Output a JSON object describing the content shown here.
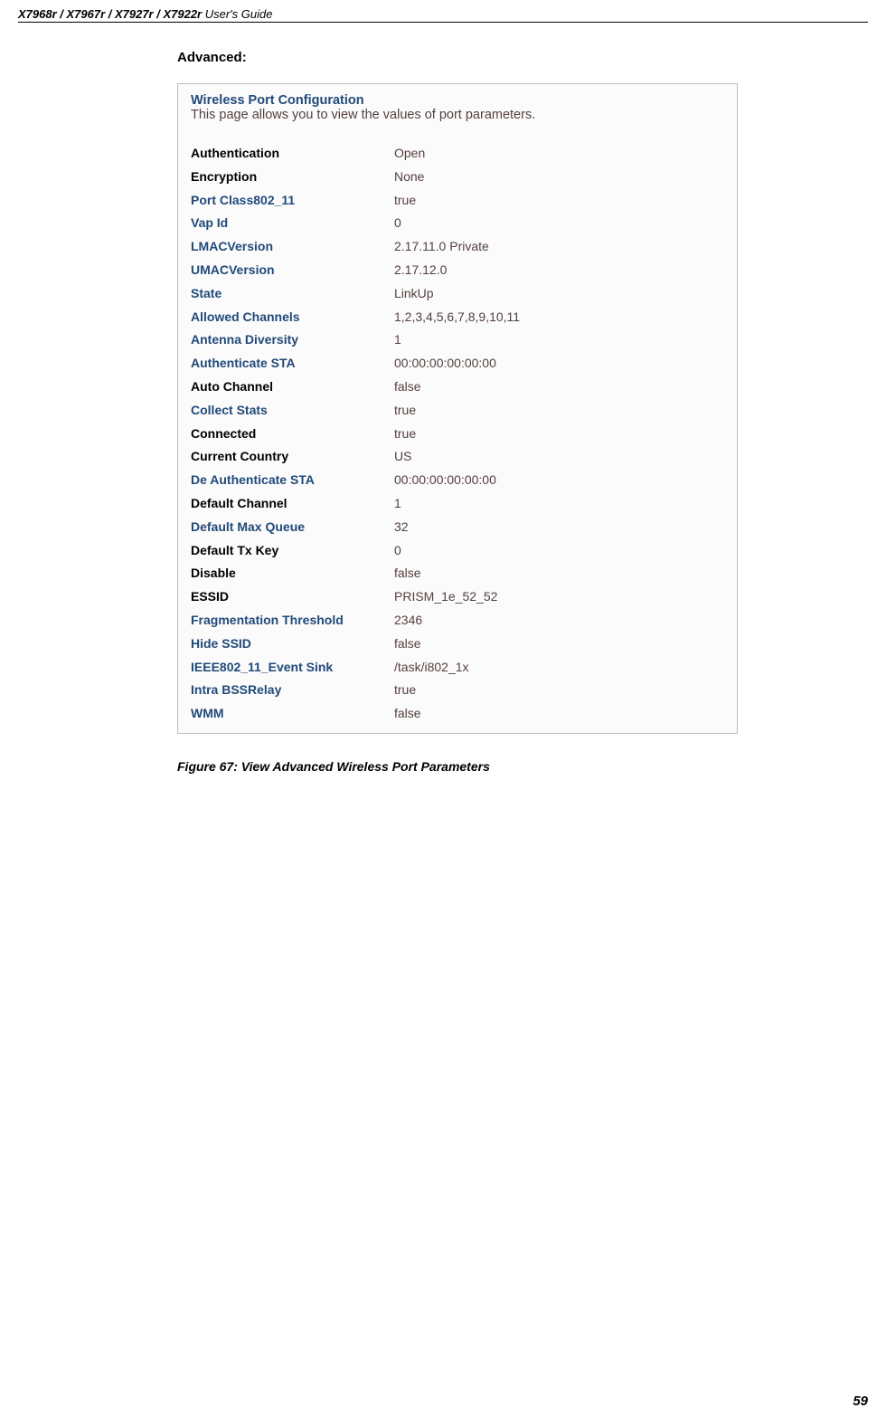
{
  "header": {
    "models": "X7968r / X7967r / X7927r / X7922r",
    "title_rest": " User's Guide"
  },
  "subheading": "Advanced:",
  "config": {
    "title": "Wireless Port Configuration",
    "desc": "This page allows you to view the values of port parameters."
  },
  "params": [
    {
      "label": "Authentication",
      "value": "Open",
      "style": "black"
    },
    {
      "label": "Encryption",
      "value": "None",
      "style": "black"
    },
    {
      "label": "Port Class802_11",
      "value": "true",
      "style": "blue"
    },
    {
      "label": "Vap Id",
      "value": "0",
      "style": "blue"
    },
    {
      "label": "LMACVersion",
      "value": "2.17.11.0 Private",
      "style": "blue"
    },
    {
      "label": "UMACVersion",
      "value": "2.17.12.0",
      "style": "blue"
    },
    {
      "label": "State",
      "value": "LinkUp",
      "style": "blue"
    },
    {
      "label": "Allowed Channels",
      "value": "1,2,3,4,5,6,7,8,9,10,11",
      "style": "blue"
    },
    {
      "label": "Antenna Diversity",
      "value": "1",
      "style": "blue"
    },
    {
      "label": "Authenticate STA",
      "value": "00:00:00:00:00:00",
      "style": "blue"
    },
    {
      "label": "Auto Channel",
      "value": "false",
      "style": "black"
    },
    {
      "label": "Collect Stats",
      "value": "true",
      "style": "blue"
    },
    {
      "label": "Connected",
      "value": "true",
      "style": "black"
    },
    {
      "label": "Current Country",
      "value": "US",
      "style": "black"
    },
    {
      "label": "De Authenticate STA",
      "value": "00:00:00:00:00:00",
      "style": "blue"
    },
    {
      "label": "Default Channel",
      "value": "1",
      "style": "black"
    },
    {
      "label": "Default Max Queue",
      "value": "32",
      "style": "blue"
    },
    {
      "label": "Default Tx Key",
      "value": "0",
      "style": "black"
    },
    {
      "label": "Disable",
      "value": "false",
      "style": "black"
    },
    {
      "label": "ESSID",
      "value": "PRISM_1e_52_52",
      "style": "black"
    },
    {
      "label": "Fragmentation Threshold",
      "value": "2346",
      "style": "blue"
    },
    {
      "label": "Hide SSID",
      "value": "false",
      "style": "blue"
    },
    {
      "label": "IEEE802_11_Event Sink",
      "value": "/task/i802_1x",
      "style": "blue"
    },
    {
      "label": "Intra BSSRelay",
      "value": "true",
      "style": "blue"
    },
    {
      "label": "WMM",
      "value": "false",
      "style": "blue"
    }
  ],
  "figure_caption": "Figure 67: View Advanced Wireless Port Parameters",
  "page_num": "59"
}
